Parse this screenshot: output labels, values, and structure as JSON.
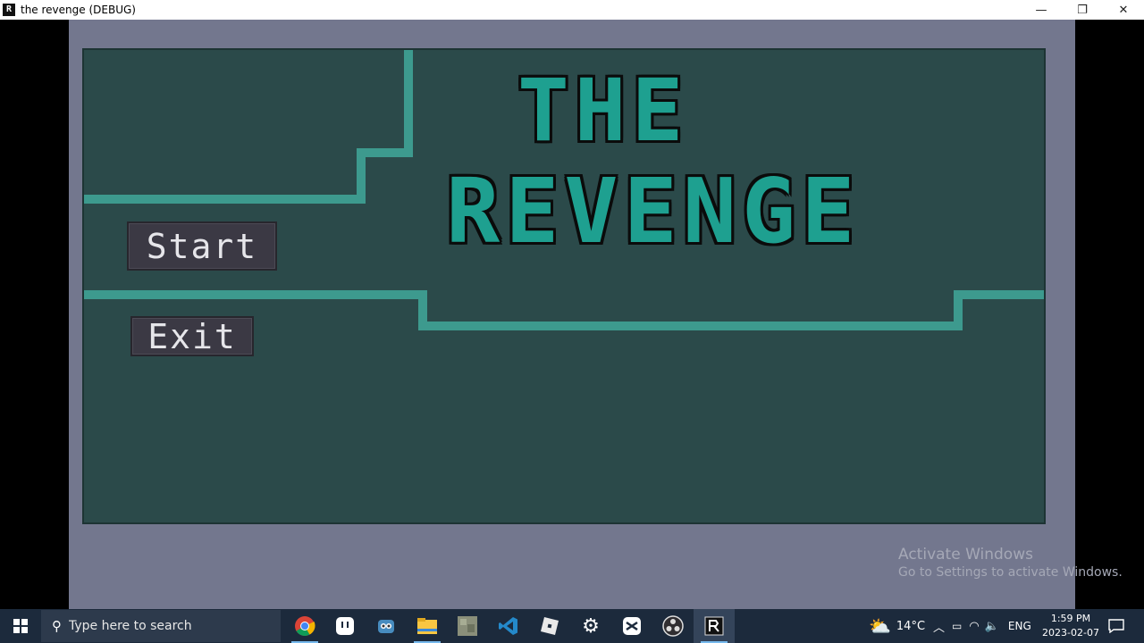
{
  "window": {
    "title": "the revenge (DEBUG)",
    "app_icon_glyph": "R",
    "minimize_glyph": "—",
    "restore_glyph": "❐",
    "close_glyph": "✕"
  },
  "game": {
    "title_line1": "THE",
    "title_line2": "REVENGE",
    "start_label": "Start",
    "exit_label": "Exit",
    "colors": {
      "outer": "#73778e",
      "panel": "#2b4a4a",
      "line": "#3d9a8e",
      "title_fill": "#1ea090",
      "button_bg": "#3b3944"
    }
  },
  "watermark": {
    "line1": "Activate Windows",
    "line2": "Go to Settings to activate Windows."
  },
  "taskbar": {
    "search_placeholder": "Type here to search",
    "icons": [
      "windows-start-icon",
      "chrome-icon",
      "app-icon",
      "godot-icon",
      "file-explorer-icon",
      "image-app-icon",
      "vscode-icon",
      "roblox-icon",
      "settings-icon",
      "capcut-icon",
      "obs-icon",
      "the-revenge-app-icon"
    ],
    "weather_temp": "14°C",
    "language": "ENG",
    "time": "1:59 PM",
    "date": "2023-02-07"
  }
}
